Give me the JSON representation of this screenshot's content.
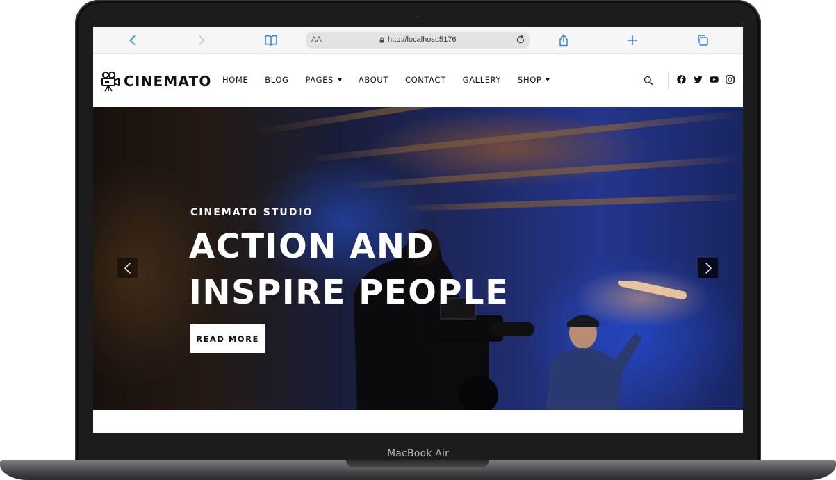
{
  "device": {
    "model_label": "MacBook Air"
  },
  "browser": {
    "text_size_label": "AA",
    "url": "http://localhost:5176"
  },
  "header": {
    "brand": "CINEMATO",
    "nav": [
      {
        "label": "HOME",
        "has_dropdown": false
      },
      {
        "label": "BLOG",
        "has_dropdown": false
      },
      {
        "label": "PAGES",
        "has_dropdown": true
      },
      {
        "label": "ABOUT",
        "has_dropdown": false
      },
      {
        "label": "CONTACT",
        "has_dropdown": false
      },
      {
        "label": "GALLERY",
        "has_dropdown": false
      },
      {
        "label": "SHOP",
        "has_dropdown": true
      }
    ],
    "social_icons": [
      "facebook-icon",
      "twitter-icon",
      "youtube-icon",
      "instagram-icon"
    ]
  },
  "hero": {
    "subtitle": "CINEMATO STUDIO",
    "title_line1": "ACTION AND",
    "title_line2": "INSPIRE PEOPLE",
    "cta_label": "READ MORE"
  },
  "colors": {
    "accent": "#2d7ff9",
    "text_dark": "#111111",
    "hero_text": "#ffffff"
  }
}
